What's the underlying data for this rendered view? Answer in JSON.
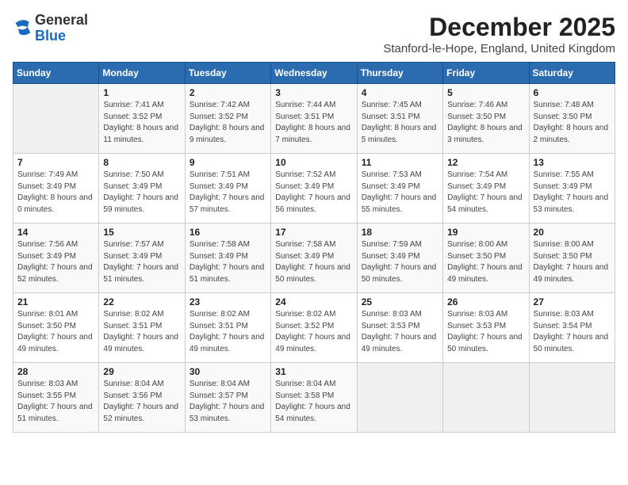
{
  "header": {
    "logo": {
      "general": "General",
      "blue": "Blue"
    },
    "title": "December 2025",
    "subtitle": "Stanford-le-Hope, England, United Kingdom"
  },
  "weekdays": [
    "Sunday",
    "Monday",
    "Tuesday",
    "Wednesday",
    "Thursday",
    "Friday",
    "Saturday"
  ],
  "weeks": [
    [
      {
        "day": "",
        "sunrise": "",
        "sunset": "",
        "daylight": ""
      },
      {
        "day": "1",
        "sunrise": "7:41 AM",
        "sunset": "3:52 PM",
        "daylight": "8 hours and 11 minutes."
      },
      {
        "day": "2",
        "sunrise": "7:42 AM",
        "sunset": "3:52 PM",
        "daylight": "8 hours and 9 minutes."
      },
      {
        "day": "3",
        "sunrise": "7:44 AM",
        "sunset": "3:51 PM",
        "daylight": "8 hours and 7 minutes."
      },
      {
        "day": "4",
        "sunrise": "7:45 AM",
        "sunset": "3:51 PM",
        "daylight": "8 hours and 5 minutes."
      },
      {
        "day": "5",
        "sunrise": "7:46 AM",
        "sunset": "3:50 PM",
        "daylight": "8 hours and 3 minutes."
      },
      {
        "day": "6",
        "sunrise": "7:48 AM",
        "sunset": "3:50 PM",
        "daylight": "8 hours and 2 minutes."
      }
    ],
    [
      {
        "day": "7",
        "sunrise": "7:49 AM",
        "sunset": "3:49 PM",
        "daylight": "8 hours and 0 minutes."
      },
      {
        "day": "8",
        "sunrise": "7:50 AM",
        "sunset": "3:49 PM",
        "daylight": "7 hours and 59 minutes."
      },
      {
        "day": "9",
        "sunrise": "7:51 AM",
        "sunset": "3:49 PM",
        "daylight": "7 hours and 57 minutes."
      },
      {
        "day": "10",
        "sunrise": "7:52 AM",
        "sunset": "3:49 PM",
        "daylight": "7 hours and 56 minutes."
      },
      {
        "day": "11",
        "sunrise": "7:53 AM",
        "sunset": "3:49 PM",
        "daylight": "7 hours and 55 minutes."
      },
      {
        "day": "12",
        "sunrise": "7:54 AM",
        "sunset": "3:49 PM",
        "daylight": "7 hours and 54 minutes."
      },
      {
        "day": "13",
        "sunrise": "7:55 AM",
        "sunset": "3:49 PM",
        "daylight": "7 hours and 53 minutes."
      }
    ],
    [
      {
        "day": "14",
        "sunrise": "7:56 AM",
        "sunset": "3:49 PM",
        "daylight": "7 hours and 52 minutes."
      },
      {
        "day": "15",
        "sunrise": "7:57 AM",
        "sunset": "3:49 PM",
        "daylight": "7 hours and 51 minutes."
      },
      {
        "day": "16",
        "sunrise": "7:58 AM",
        "sunset": "3:49 PM",
        "daylight": "7 hours and 51 minutes."
      },
      {
        "day": "17",
        "sunrise": "7:58 AM",
        "sunset": "3:49 PM",
        "daylight": "7 hours and 50 minutes."
      },
      {
        "day": "18",
        "sunrise": "7:59 AM",
        "sunset": "3:49 PM",
        "daylight": "7 hours and 50 minutes."
      },
      {
        "day": "19",
        "sunrise": "8:00 AM",
        "sunset": "3:50 PM",
        "daylight": "7 hours and 49 minutes."
      },
      {
        "day": "20",
        "sunrise": "8:00 AM",
        "sunset": "3:50 PM",
        "daylight": "7 hours and 49 minutes."
      }
    ],
    [
      {
        "day": "21",
        "sunrise": "8:01 AM",
        "sunset": "3:50 PM",
        "daylight": "7 hours and 49 minutes."
      },
      {
        "day": "22",
        "sunrise": "8:02 AM",
        "sunset": "3:51 PM",
        "daylight": "7 hours and 49 minutes."
      },
      {
        "day": "23",
        "sunrise": "8:02 AM",
        "sunset": "3:51 PM",
        "daylight": "7 hours and 49 minutes."
      },
      {
        "day": "24",
        "sunrise": "8:02 AM",
        "sunset": "3:52 PM",
        "daylight": "7 hours and 49 minutes."
      },
      {
        "day": "25",
        "sunrise": "8:03 AM",
        "sunset": "3:53 PM",
        "daylight": "7 hours and 49 minutes."
      },
      {
        "day": "26",
        "sunrise": "8:03 AM",
        "sunset": "3:53 PM",
        "daylight": "7 hours and 50 minutes."
      },
      {
        "day": "27",
        "sunrise": "8:03 AM",
        "sunset": "3:54 PM",
        "daylight": "7 hours and 50 minutes."
      }
    ],
    [
      {
        "day": "28",
        "sunrise": "8:03 AM",
        "sunset": "3:55 PM",
        "daylight": "7 hours and 51 minutes."
      },
      {
        "day": "29",
        "sunrise": "8:04 AM",
        "sunset": "3:56 PM",
        "daylight": "7 hours and 52 minutes."
      },
      {
        "day": "30",
        "sunrise": "8:04 AM",
        "sunset": "3:57 PM",
        "daylight": "7 hours and 53 minutes."
      },
      {
        "day": "31",
        "sunrise": "8:04 AM",
        "sunset": "3:58 PM",
        "daylight": "7 hours and 54 minutes."
      },
      {
        "day": "",
        "sunrise": "",
        "sunset": "",
        "daylight": ""
      },
      {
        "day": "",
        "sunrise": "",
        "sunset": "",
        "daylight": ""
      },
      {
        "day": "",
        "sunrise": "",
        "sunset": "",
        "daylight": ""
      }
    ]
  ],
  "labels": {
    "sunrise_prefix": "Sunrise: ",
    "sunset_prefix": "Sunset: ",
    "daylight_prefix": "Daylight: "
  }
}
